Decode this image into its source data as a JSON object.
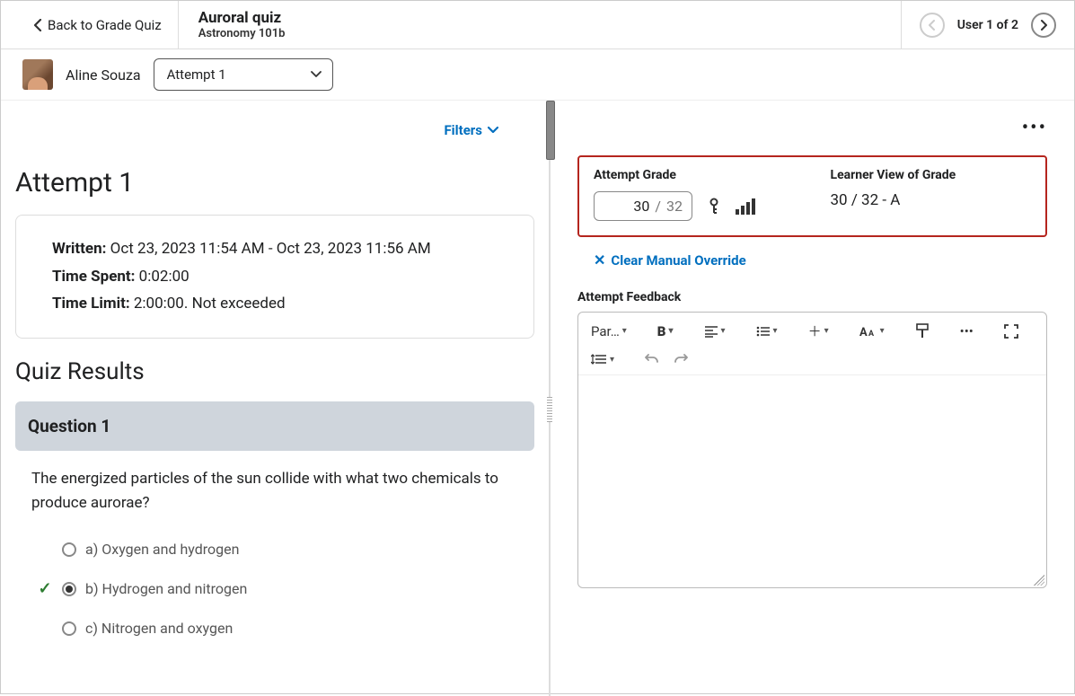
{
  "header": {
    "back_label": "Back to Grade Quiz",
    "title": "Auroral quiz",
    "subtitle": "Astronomy 101b",
    "user_counter": "User 1 of 2"
  },
  "subheader": {
    "user_name": "Aline Souza",
    "attempt_select_label": "Attempt 1"
  },
  "left": {
    "filters_label": "Filters",
    "attempt_heading": "Attempt 1",
    "meta": {
      "written_label": "Written:",
      "written_value": "Oct 23, 2023 11:54 AM - Oct 23, 2023 11:56 AM",
      "time_spent_label": "Time Spent:",
      "time_spent_value": "0:02:00",
      "time_limit_label": "Time Limit:",
      "time_limit_value": "2:00:00. Not exceeded"
    },
    "results_heading": "Quiz Results",
    "question": {
      "header": "Question 1",
      "text": "The energized particles of the sun collide with what two chemicals to produce aurorae?",
      "options": [
        {
          "label": "a)  Oxygen and hydrogen",
          "selected": false,
          "correct": false
        },
        {
          "label": "b)  Hydrogen and nitrogen",
          "selected": true,
          "correct": true
        },
        {
          "label": "c)  Nitrogen and oxygen",
          "selected": false,
          "correct": false
        }
      ]
    }
  },
  "right": {
    "attempt_grade_label": "Attempt Grade",
    "grade_value": "30",
    "grade_denominator": "32",
    "learner_view_label": "Learner View of Grade",
    "learner_view_value": "30 / 32 - A",
    "clear_override_label": "Clear Manual Override",
    "feedback_label": "Attempt Feedback",
    "toolbar": {
      "paragraph": "Par…"
    }
  }
}
